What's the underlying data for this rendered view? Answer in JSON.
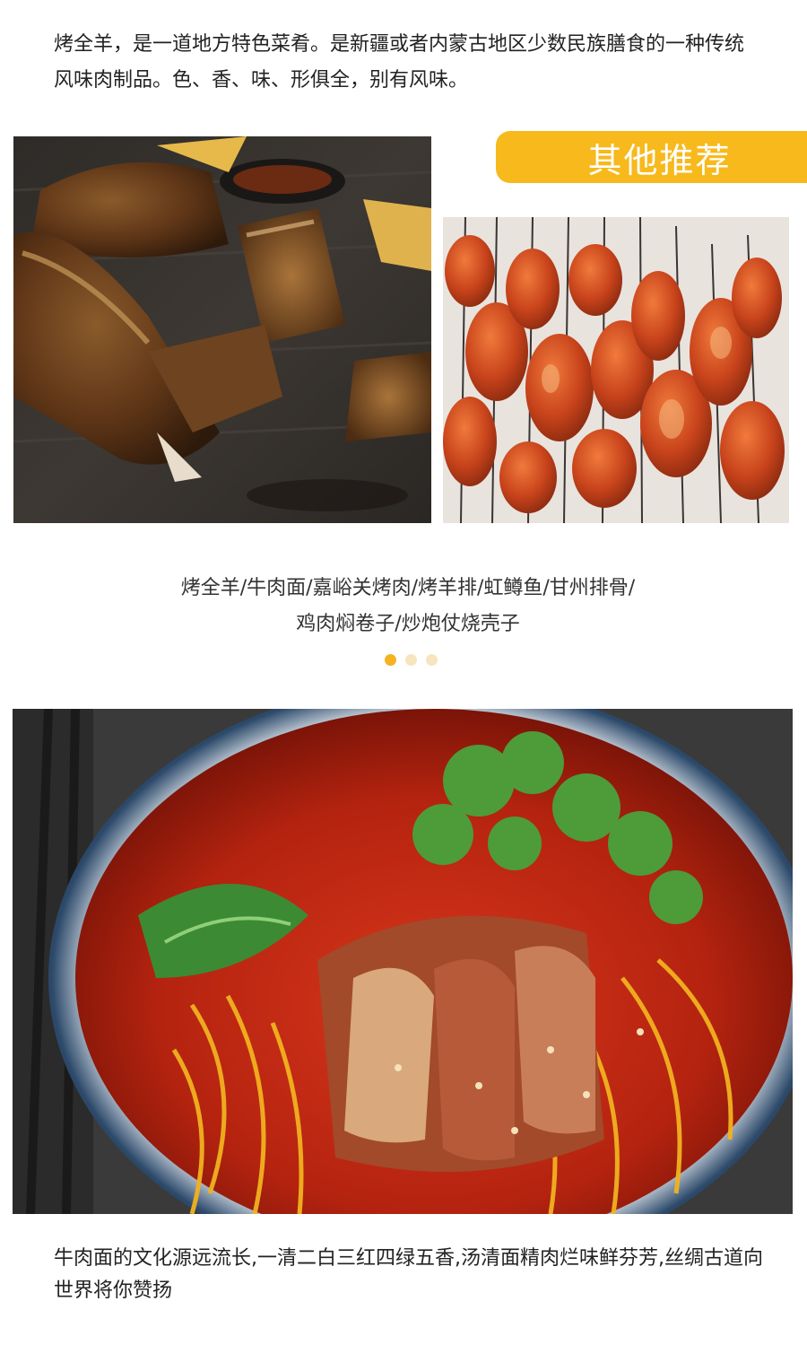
{
  "intro": {
    "text": "烤全羊，是一道地方特色菜肴。是新疆或者内蒙古地区少数民族膳食的一种传统风味肉制品。色、香、味、形俱全，别有风味。"
  },
  "recommend": {
    "title": "其他推荐",
    "accent_color": "#f7b91c",
    "dishes_line1": "烤全羊/牛肉面/嘉峪关烤肉/烤羊排/虹鳟鱼/甘州排骨/",
    "dishes_line2": "鸡肉焖卷子/炒炮仗烧壳子",
    "carousel_active_index": 0,
    "carousel_count": 3
  },
  "noodle": {
    "caption": "牛肉面的文化源远流长,一清二白三红四绿五香,汤清面精肉烂味鲜芬芳,丝绸古道向世界将你赞扬"
  }
}
